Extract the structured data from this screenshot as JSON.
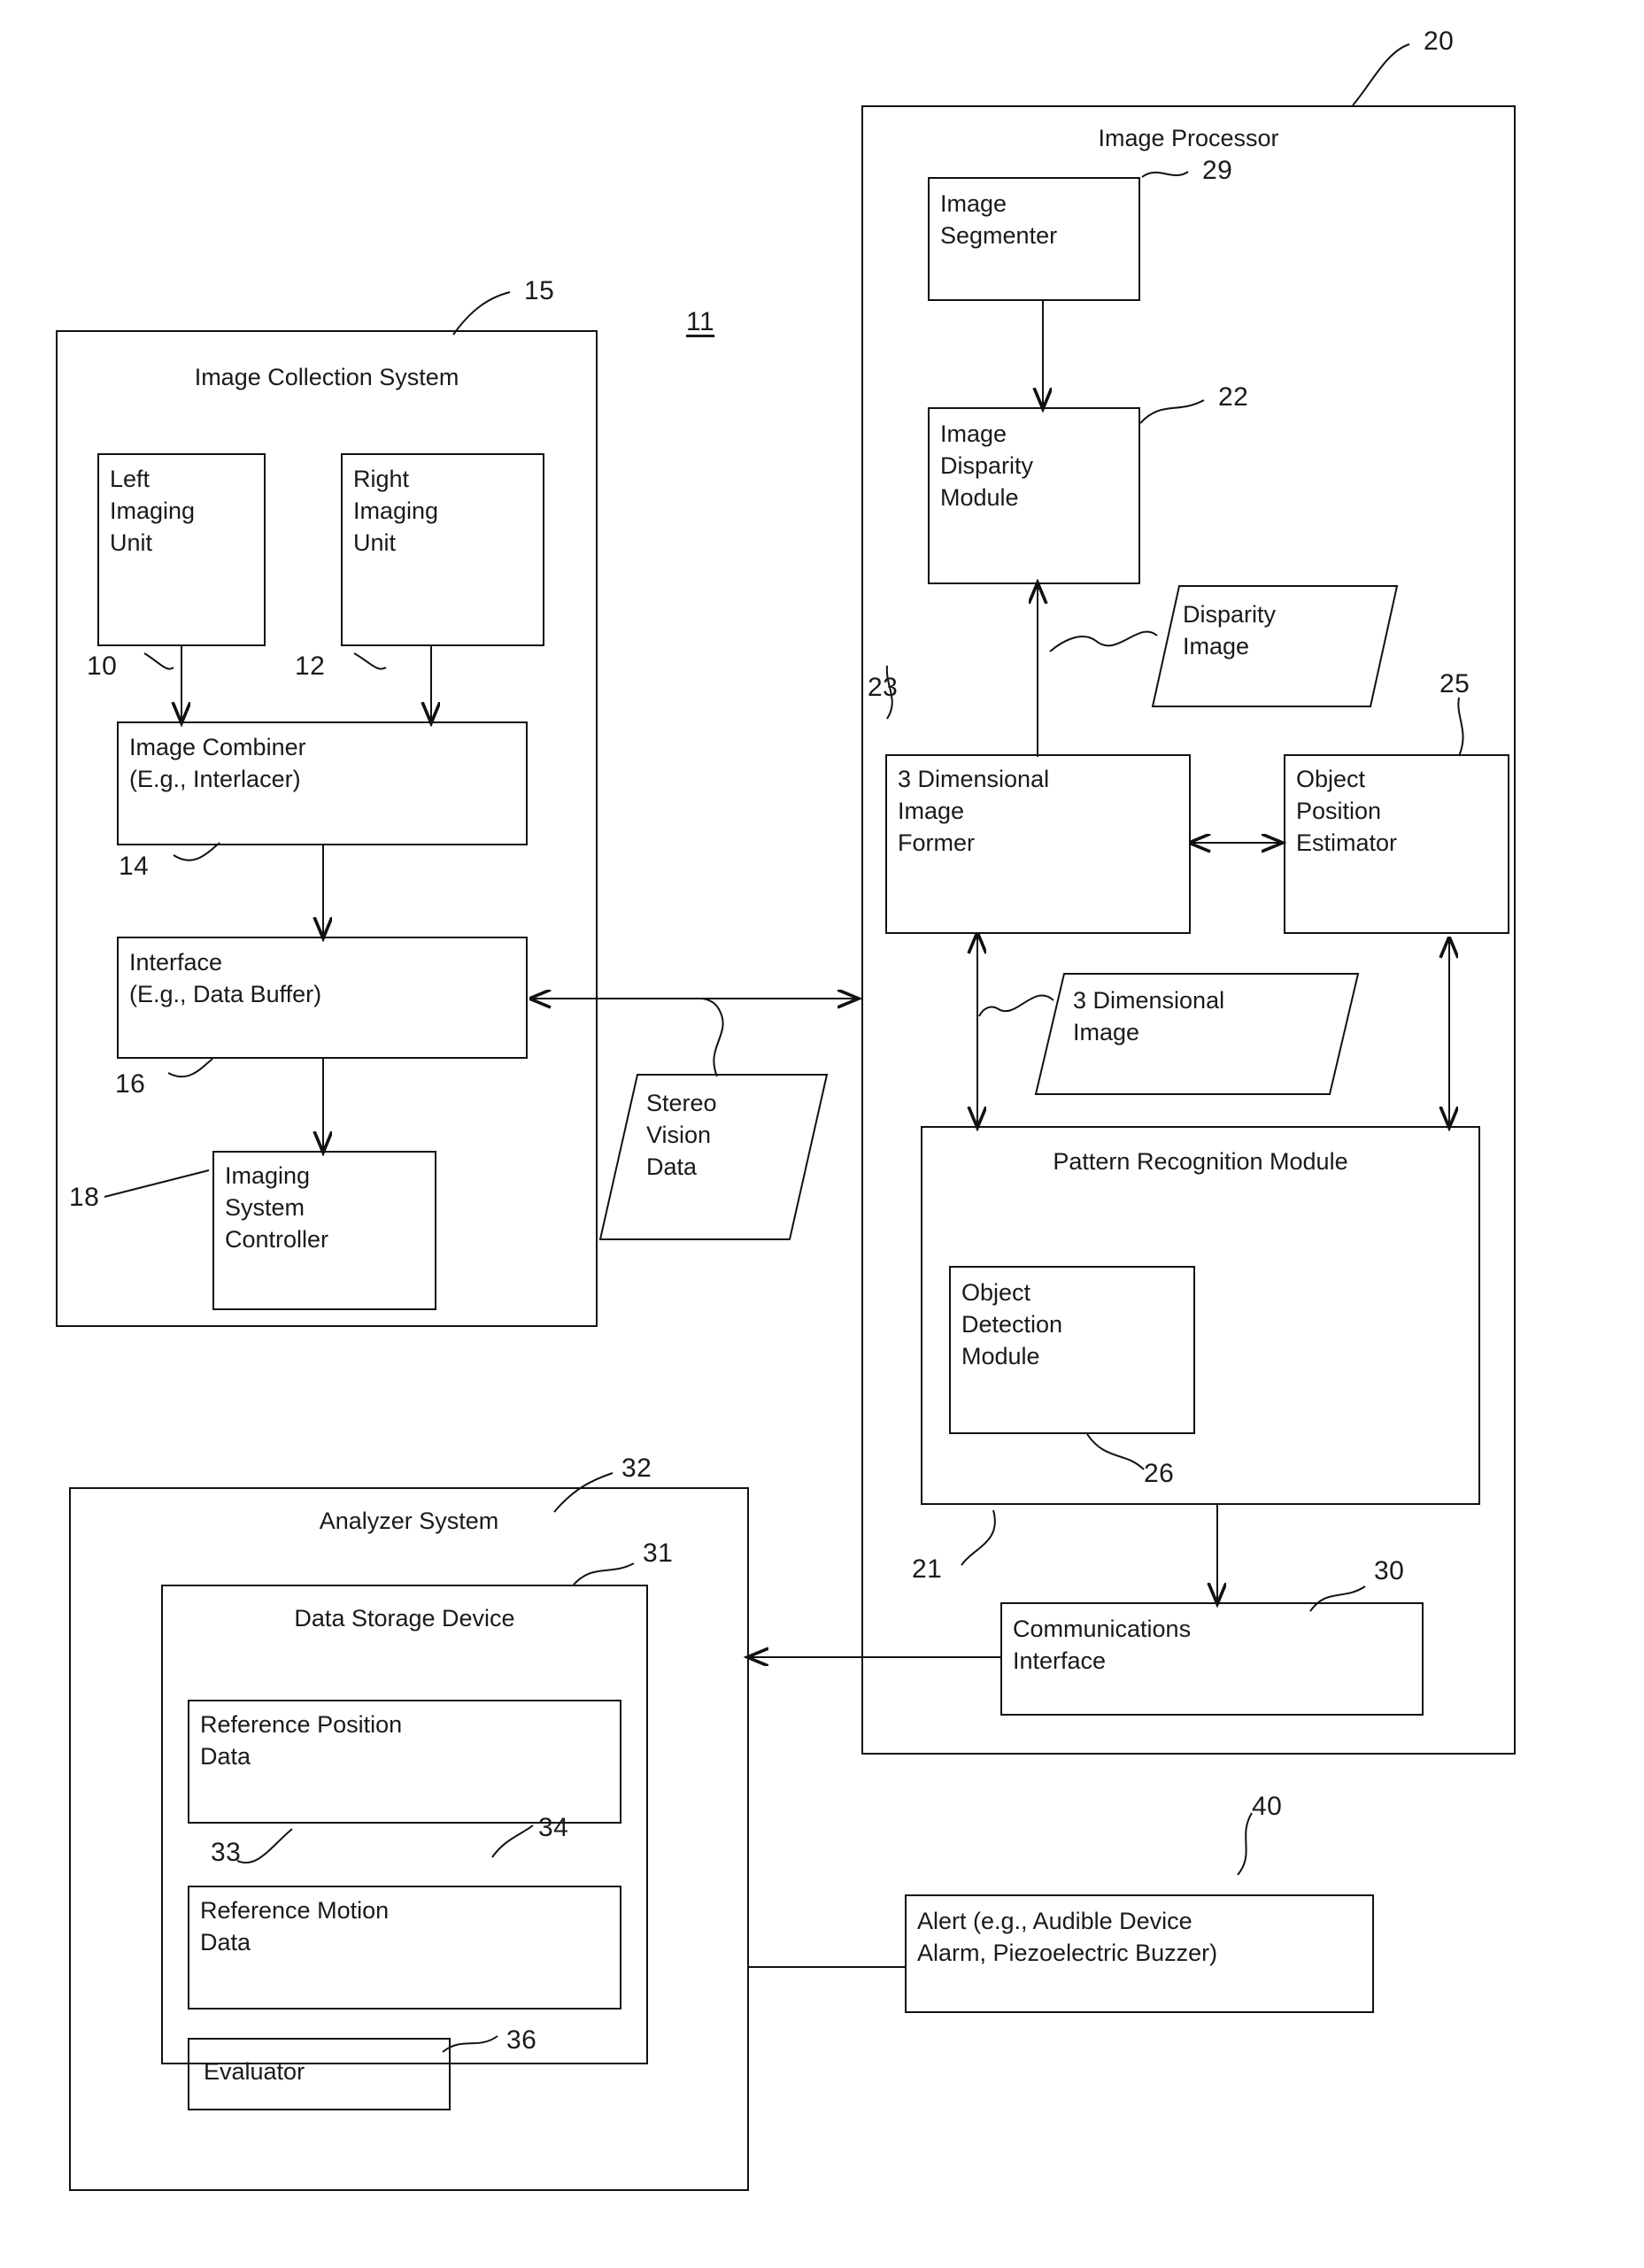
{
  "figure": {
    "system_ref": "11"
  },
  "image_collection_system": {
    "title": "Image Collection System",
    "ref": "15",
    "left_imaging_unit": {
      "label": "Left\nImaging\nUnit",
      "ref": "10"
    },
    "right_imaging_unit": {
      "label": "Right\nImaging\nUnit",
      "ref": "12"
    },
    "image_combiner": {
      "label": "Image Combiner\n(E.g., Interlacer)",
      "ref": "14"
    },
    "interface": {
      "label": "Interface\n(E.g., Data Buffer)",
      "ref": "16"
    },
    "imaging_system_controller": {
      "label": "Imaging\nSystem\nController",
      "ref": "18"
    }
  },
  "stereo_vision_data": {
    "label": "Stereo\nVision\nData"
  },
  "image_processor": {
    "title": "Image Processor",
    "ref": "20",
    "image_segmenter": {
      "label": "Image\nSegmenter",
      "ref": "29"
    },
    "image_disparity_module": {
      "label": "Image\nDisparity\nModule",
      "ref": "22"
    },
    "disparity_image": {
      "label": "Disparity\nImage"
    },
    "three_dimensional_image_former": {
      "label": "3 Dimensional\nImage\nFormer",
      "ref": "23"
    },
    "object_position_estimator": {
      "label": "Object\nPosition\nEstimator",
      "ref": "25"
    },
    "three_dimensional_image": {
      "label": "3 Dimensional\nImage"
    },
    "pattern_recognition_module": {
      "title": "Pattern Recognition Module",
      "ref": "21",
      "object_detection_module": {
        "label": "Object\nDetection\nModule",
        "ref": "26"
      }
    },
    "communications_interface": {
      "label": "Communications\nInterface",
      "ref": "30"
    }
  },
  "analyzer_system": {
    "title": "Analyzer System",
    "ref": "32",
    "data_storage_device": {
      "title": "Data Storage Device",
      "ref": "31",
      "reference_position_data": {
        "label": "Reference Position\nData",
        "ref": "33"
      },
      "reference_motion_data": {
        "label": "Reference Motion\nData",
        "ref": "34"
      }
    },
    "evaluator": {
      "label": "Evaluator",
      "ref": "36"
    }
  },
  "alert": {
    "label": "Alert (e.g., Audible Device\nAlarm, Piezoelectric Buzzer)",
    "ref": "40"
  }
}
